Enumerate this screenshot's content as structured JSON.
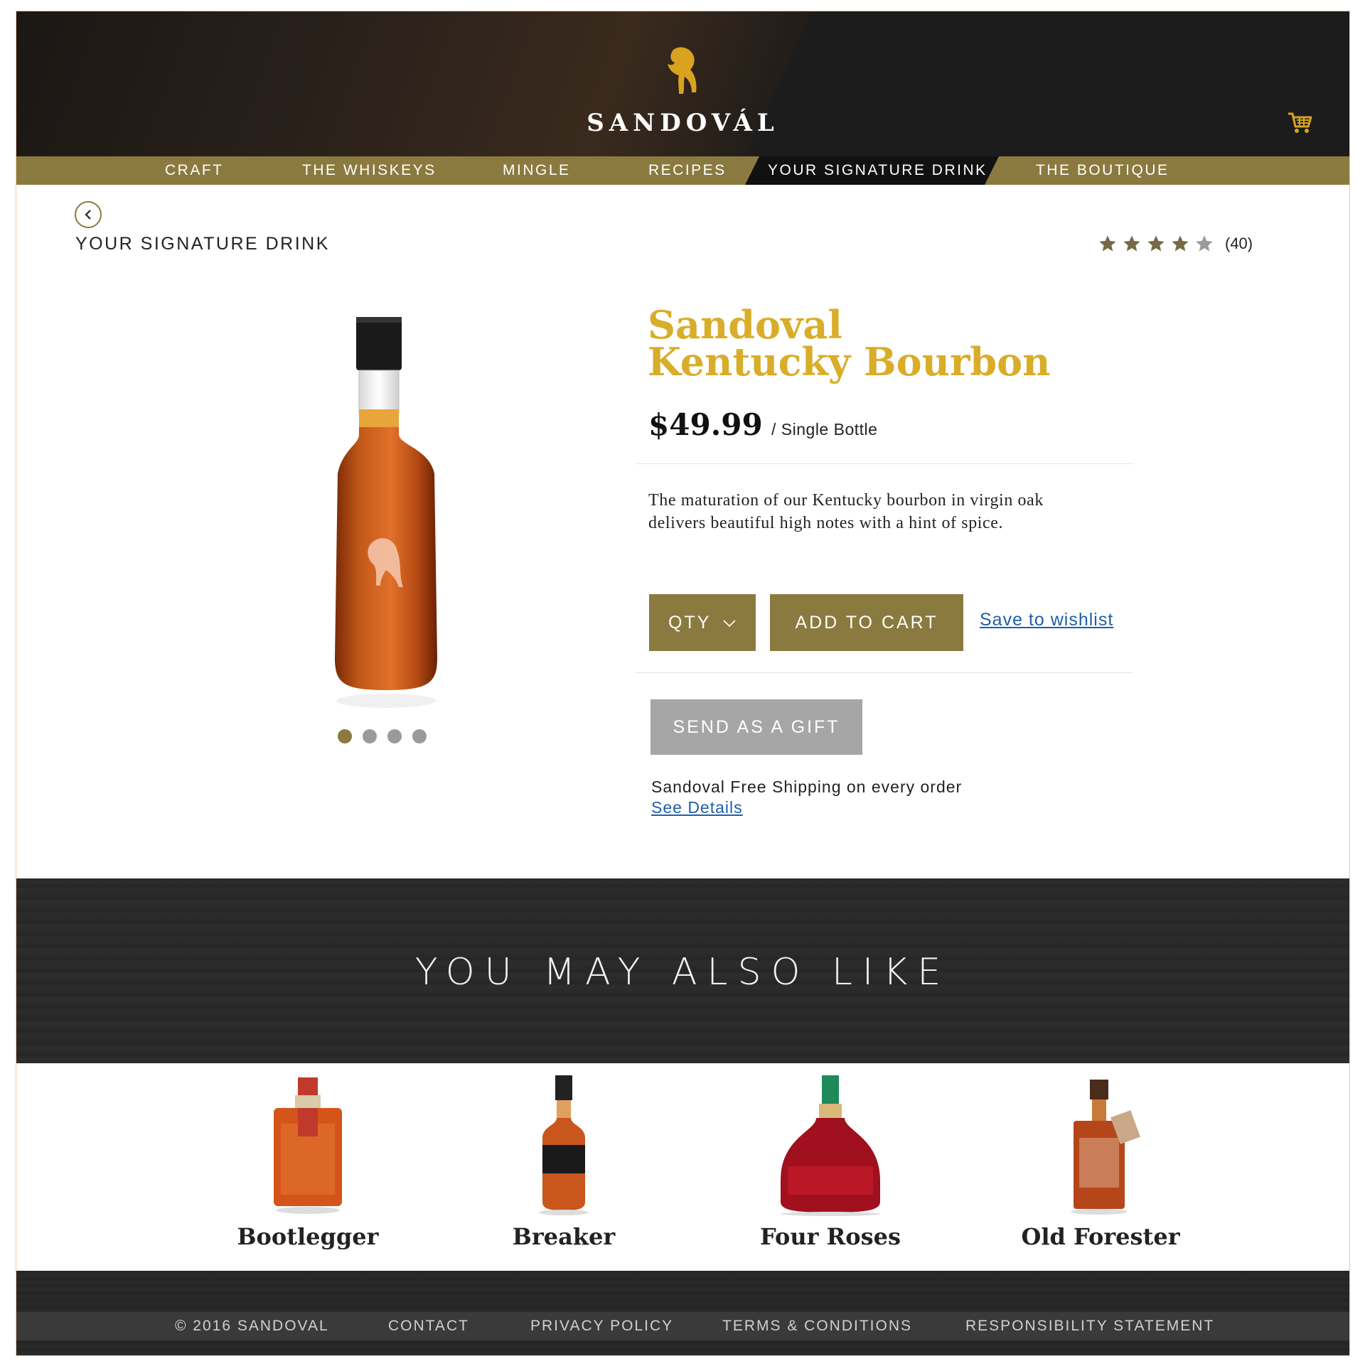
{
  "brand": {
    "name": "SANDOVÁL"
  },
  "nav": {
    "items": [
      {
        "label": "CRAFT"
      },
      {
        "label": "THE WHISKEYS"
      },
      {
        "label": "MINGLE"
      },
      {
        "label": "RECIPES"
      },
      {
        "label": "YOUR SIGNATURE DRINK"
      },
      {
        "label": "THE BOUTIQUE"
      }
    ],
    "active": "YOUR SIGNATURE DRINK"
  },
  "page": {
    "section_label": "YOUR SIGNATURE DRINK",
    "rating": {
      "stars_filled": 4,
      "stars_total": 5,
      "count": "(40)"
    }
  },
  "product": {
    "title_line1": "Sandoval",
    "title_line2": "Kentucky Bourbon",
    "price": "$49.99",
    "price_unit": "/ Single Bottle",
    "description": "The maturation of our Kentucky bourbon in virgin oak delivers beautiful high notes with a hint of spice.",
    "qty_label": "QTY",
    "add_to_cart_label": "ADD TO CART",
    "wishlist_label": "Save to wishlist",
    "gift_label": "SEND AS A GIFT",
    "shipping_text": "Sandoval Free Shipping on every order",
    "details_link": "See Details",
    "carousel": {
      "total": 4,
      "active": 1
    }
  },
  "also_like": {
    "title": "YOU MAY ALSO LIKE",
    "items": [
      {
        "name": "Bootlegger"
      },
      {
        "name": "Breaker"
      },
      {
        "name": "Four Roses"
      },
      {
        "name": "Old Forester"
      }
    ]
  },
  "footer": {
    "links": [
      {
        "label": "© 2016 SANDOVAL"
      },
      {
        "label": "CONTACT"
      },
      {
        "label": "PRIVACY POLICY"
      },
      {
        "label": "TERMS & CONDITIONS"
      },
      {
        "label": "RESPONSIBILITY STATEMENT"
      }
    ]
  },
  "colors": {
    "accent_gold": "#8b7a3f",
    "title_gold": "#d9ad2a",
    "link_blue": "#1e5fa8",
    "gift_gray": "#a6a6a6"
  },
  "icons": [
    "horse-logo-icon",
    "cart-icon",
    "back-arrow-icon",
    "star-icon",
    "chevron-down-icon"
  ]
}
